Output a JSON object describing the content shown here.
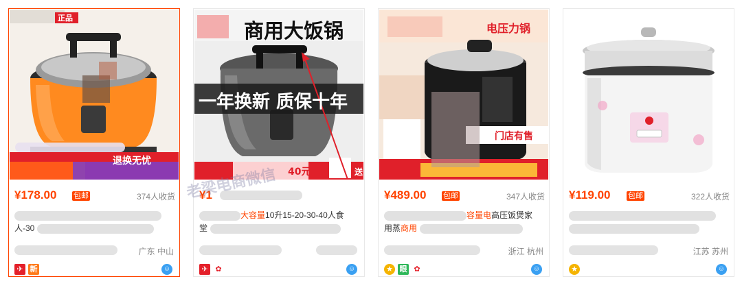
{
  "products": [
    {
      "image_tag": "正品",
      "image_banner": "退换无忧",
      "price": "¥178.00",
      "free_shipping": "包邮",
      "sold": "374人收货",
      "title_line1": "",
      "title_line2": "人-30",
      "location": "广东 中山",
      "badge_new": "新",
      "accent": "#ff8a1f"
    },
    {
      "image_headline": "商用大饭锅",
      "image_banner": "一年换新 质保十年",
      "image_price_tail": "40元",
      "image_send": "送",
      "price": "¥1",
      "sold": "",
      "title_highlight": "大容量",
      "title_rest": "10升15-20-30-40人食",
      "title_line2": "堂",
      "location": "",
      "accent": "#4a4a4a"
    },
    {
      "image_headline": "电压力锅",
      "image_banner": "门店有售",
      "price": "¥489.00",
      "free_shipping": "包邮",
      "sold": "347人收货",
      "title_highlight_a": "容量电",
      "title_rest": "高压饭煲家",
      "title_line2_a": "用蒸",
      "title_line2_hl": "商用",
      "location": "浙江 杭州",
      "badge_text": "眼",
      "accent": "#e33b2e"
    },
    {
      "price": "¥119.00",
      "free_shipping": "包邮",
      "sold": "322人收货",
      "location": "江苏 苏州",
      "accent": "#f2f2f2"
    }
  ],
  "watermark_text": "老梁电商微信"
}
